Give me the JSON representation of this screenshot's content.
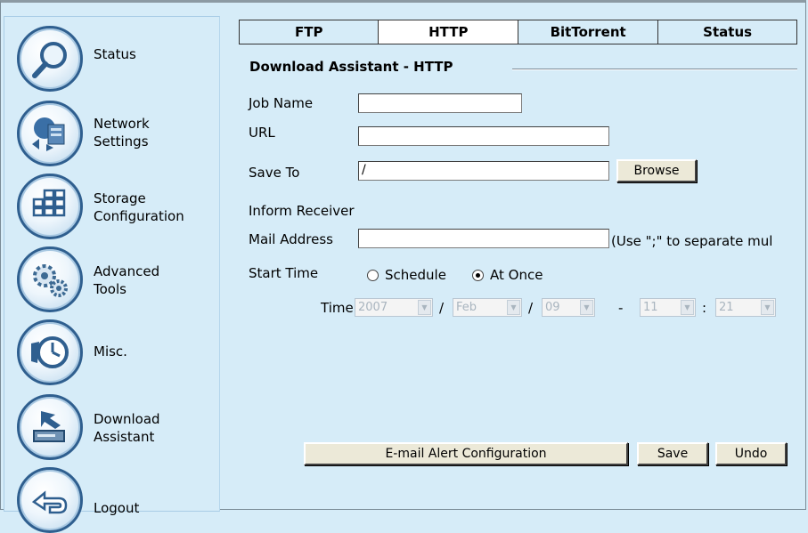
{
  "sidebar": {
    "items": [
      {
        "label": "Status",
        "icon": "magnifier-icon"
      },
      {
        "label": "Network\nSettings",
        "icon": "network-globe-icon"
      },
      {
        "label": "Storage\nConfiguration",
        "icon": "storage-grid-icon"
      },
      {
        "label": "Advanced\nTools",
        "icon": "gears-icon"
      },
      {
        "label": "Misc.",
        "icon": "clock-icon"
      },
      {
        "label": "Download\nAssistant",
        "icon": "download-tray-icon"
      },
      {
        "label": "Logout",
        "icon": "logout-arrow-icon"
      }
    ]
  },
  "tabs": [
    {
      "label": "FTP",
      "active": false
    },
    {
      "label": "HTTP",
      "active": true
    },
    {
      "label": "BitTorrent",
      "active": false
    },
    {
      "label": "Status",
      "active": false
    }
  ],
  "form": {
    "section_title": "Download Assistant - HTTP",
    "job_name_label": "Job Name",
    "job_name_value": "",
    "url_label": "URL",
    "url_value": "",
    "save_to_label": "Save To",
    "save_to_value": "/",
    "browse_label": "Browse",
    "inform_receiver_label": "Inform Receiver",
    "mail_address_label": "Mail Address",
    "mail_address_value": "",
    "mail_hint": "(Use \";\" to separate mul",
    "start_time_label": "Start Time",
    "schedule_label": "Schedule",
    "at_once_label": "At Once",
    "selected_start": "At Once",
    "time_label": "Time",
    "year": "2007",
    "month": "Feb",
    "day": "09",
    "hour": "11",
    "minute": "21",
    "date_sep": "/",
    "dash_sep": "-",
    "colon_sep": ":"
  },
  "buttons": {
    "email_alert": "E-mail Alert Configuration",
    "save": "Save",
    "undo": "Undo"
  }
}
